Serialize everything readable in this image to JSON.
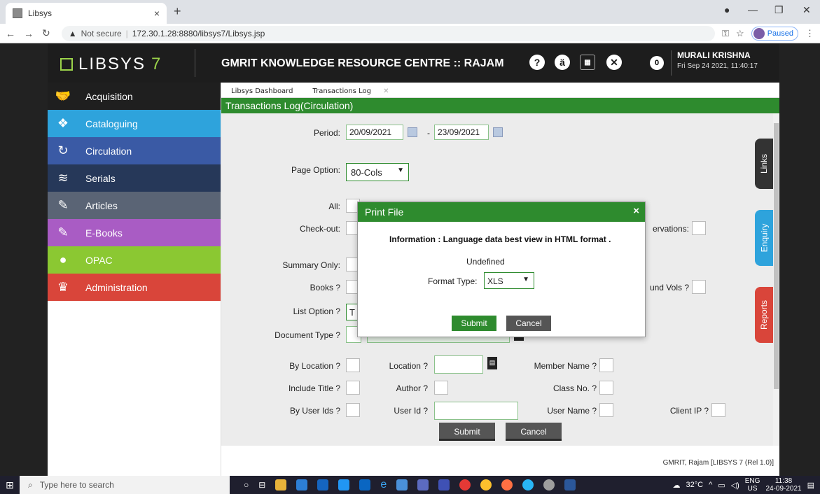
{
  "browser": {
    "tab_title": "Libsys",
    "tab_close": "×",
    "new_tab": "+",
    "url_warning": "Not secure",
    "url": "172.30.1.28:8880/libsys7/Libsys.jsp",
    "profile_status": "Paused"
  },
  "header": {
    "logo_text": "LIBSYS",
    "logo_version": "7",
    "title": "GMRIT KNOWLEDGE RESOURCE CENTRE :: RAJAM",
    "notification_count": "0",
    "user_name": "MURALI KRISHNA",
    "datetime": "Fri Sep 24 2021, 11:40:17"
  },
  "sidebar": {
    "items": [
      {
        "label": "Acquisition",
        "color": "#1f1f1f"
      },
      {
        "label": "Cataloguing",
        "color": "#2ea3dc"
      },
      {
        "label": "Circulation",
        "color": "#3a5aa5"
      },
      {
        "label": "Serials",
        "color": "#263859"
      },
      {
        "label": "Articles",
        "color": "#5a6475"
      },
      {
        "label": "E-Books",
        "color": "#a95cc4"
      },
      {
        "label": "OPAC",
        "color": "#8bc832"
      },
      {
        "label": "Administration",
        "color": "#d9453a"
      }
    ]
  },
  "tabs": [
    {
      "label": "Libsys Dashboard"
    },
    {
      "label": "Transactions Log",
      "close": "✕"
    }
  ],
  "section_title": "Transactions Log(Circulation)",
  "form": {
    "period_label": "Period:",
    "period_from": "20/09/2021",
    "period_sep": "-",
    "period_to": "23/09/2021",
    "page_option_label": "Page Option:",
    "page_option_value": "80-Cols",
    "all_label": "All:",
    "checkout_label": "Check-out:",
    "reservations_label": "ervations:",
    "summary_label": "Summary Only:",
    "books_label": "Books ?",
    "bound_vols_label": "und Vols ?",
    "list_option_label": "List Option ?",
    "list_option_value": "T",
    "document_type_label": "Document Type ?",
    "by_location_label": "By Location ?",
    "location_label": "Location ?",
    "member_name_label": "Member Name ?",
    "include_title_label": "Include Title ?",
    "author_label": "Author ?",
    "class_no_label": "Class No. ?",
    "by_user_ids_label": "By User Ids ?",
    "user_id_label": "User Id ?",
    "user_name_label": "User Name ?",
    "client_ip_label": "Client IP ?",
    "submit": "Submit",
    "cancel": "Cancel"
  },
  "side_tabs": {
    "links": "Links",
    "enquiry": "Enquiry",
    "reports": "Reports"
  },
  "footer": "GMRIT, Rajam [LIBSYS 7 (Rel 1.0)]",
  "modal": {
    "title": "Print File",
    "close": "×",
    "info": "Information : Language data best view in HTML format .",
    "undefined_text": "Undefined",
    "format_label": "Format Type:",
    "format_value": "XLS",
    "submit": "Submit",
    "cancel": "Cancel"
  },
  "taskbar": {
    "search_placeholder": "Type here to search",
    "weather": "32°C",
    "lang_top": "ENG",
    "lang_bottom": "US",
    "time": "11:38",
    "date": "24-09-2021"
  }
}
